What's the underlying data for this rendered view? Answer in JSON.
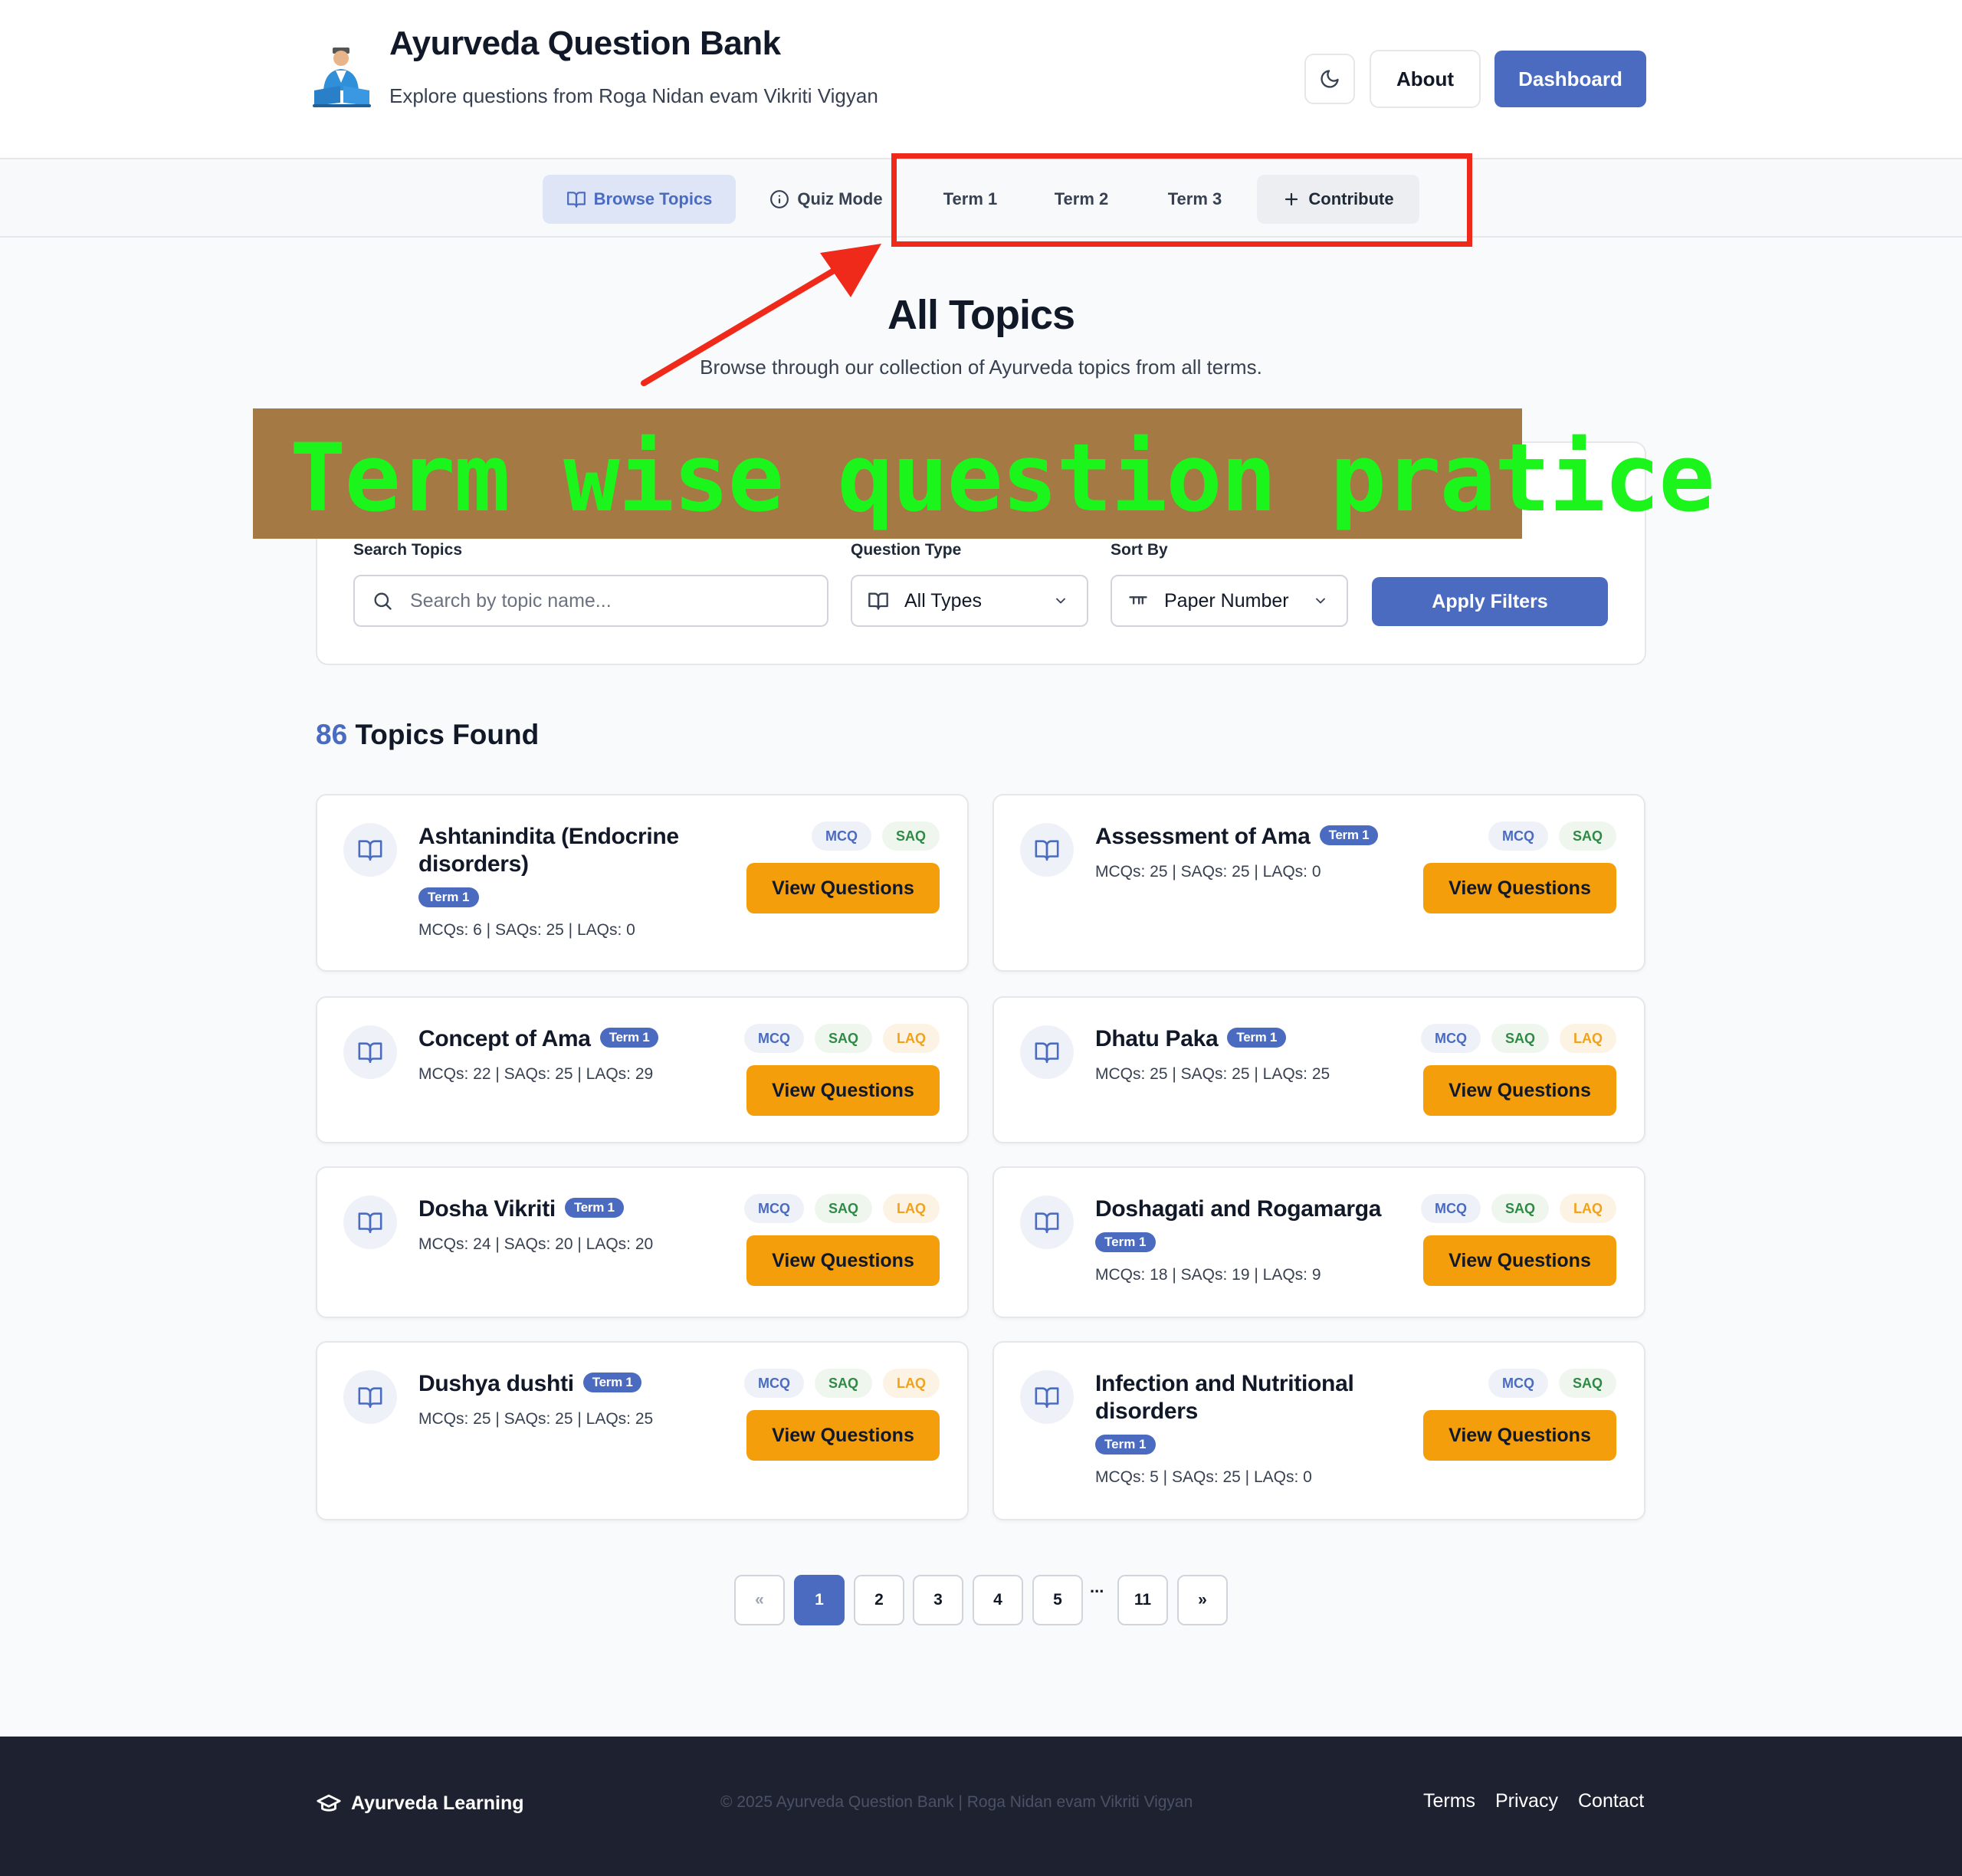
{
  "header": {
    "title": "Ayurveda Question Bank",
    "subtitle": "Explore questions from Roga Nidan evam Vikriti Vigyan",
    "theme_icon": "moon-icon",
    "about_label": "About",
    "dashboard_label": "Dashboard"
  },
  "nav": {
    "browse_label": "Browse Topics",
    "quiz_label": "Quiz Mode",
    "term1_label": "Term 1",
    "term2_label": "Term 2",
    "term3_label": "Term 3",
    "contribute_label": "Contribute"
  },
  "hero": {
    "title": "All Topics",
    "subtitle": "Browse through our collection of Ayurveda topics from all terms."
  },
  "annotation": {
    "banner_text": "Term wise question pratice"
  },
  "filters": {
    "search_label": "Search Topics",
    "search_placeholder": "Search by topic name...",
    "type_label": "Question Type",
    "type_value": "All Types",
    "sort_label": "Sort By",
    "sort_value": "Paper Number",
    "apply_label": "Apply Filters"
  },
  "results": {
    "count": "86",
    "label": "Topics Found"
  },
  "cards": [
    {
      "name": "Ashtanindita (Endocrine disorders)",
      "term": "Term 1",
      "stats": "MCQs: 6 | SAQs: 25 | LAQs: 0",
      "types": [
        "MCQ",
        "SAQ"
      ],
      "button": "View Questions"
    },
    {
      "name": "Assessment of Ama",
      "term": "Term 1",
      "stats": "MCQs: 25 | SAQs: 25 | LAQs: 0",
      "types": [
        "MCQ",
        "SAQ"
      ],
      "button": "View Questions"
    },
    {
      "name": "Concept of Ama",
      "term": "Term 1",
      "stats": "MCQs: 22 | SAQs: 25 | LAQs: 29",
      "types": [
        "MCQ",
        "SAQ",
        "LAQ"
      ],
      "button": "View Questions"
    },
    {
      "name": "Dhatu Paka",
      "term": "Term 1",
      "stats": "MCQs: 25 | SAQs: 25 | LAQs: 25",
      "types": [
        "MCQ",
        "SAQ",
        "LAQ"
      ],
      "button": "View Questions"
    },
    {
      "name": "Dosha Vikriti",
      "term": "Term 1",
      "stats": "MCQs: 24 | SAQs: 20 | LAQs: 20",
      "types": [
        "MCQ",
        "SAQ",
        "LAQ"
      ],
      "button": "View Questions"
    },
    {
      "name": "Doshagati and Rogamarga",
      "term": "Term 1",
      "stats": "MCQs: 18 | SAQs: 19 | LAQs: 9",
      "types": [
        "MCQ",
        "SAQ",
        "LAQ"
      ],
      "button": "View Questions"
    },
    {
      "name": "Dushya dushti",
      "term": "Term 1",
      "stats": "MCQs: 25 | SAQs: 25 | LAQs: 25",
      "types": [
        "MCQ",
        "SAQ",
        "LAQ"
      ],
      "button": "View Questions"
    },
    {
      "name": "Infection and Nutritional disorders",
      "term": "Term 1",
      "stats": "MCQs: 5 | SAQs: 25 | LAQs: 0",
      "types": [
        "MCQ",
        "SAQ"
      ],
      "button": "View Questions"
    }
  ],
  "pagination": {
    "prev": "«",
    "pages": [
      "1",
      "2",
      "3",
      "4",
      "5"
    ],
    "ellipsis": "...",
    "last": "11",
    "next": "»"
  },
  "footer": {
    "brand": "Ayurveda Learning",
    "copyright": "© 2025 Ayurveda Question Bank | Roga Nidan evam Vikriti Vigyan",
    "terms": "Terms",
    "privacy": "Privacy",
    "contact": "Contact"
  },
  "colors": {
    "primary": "#4a6bc0",
    "accent_button": "#f59e0b",
    "annotation_red": "#f02a1a",
    "banner_bg": "#a57943",
    "banner_text": "#1cf51c",
    "footer_bg": "#1e2230"
  }
}
